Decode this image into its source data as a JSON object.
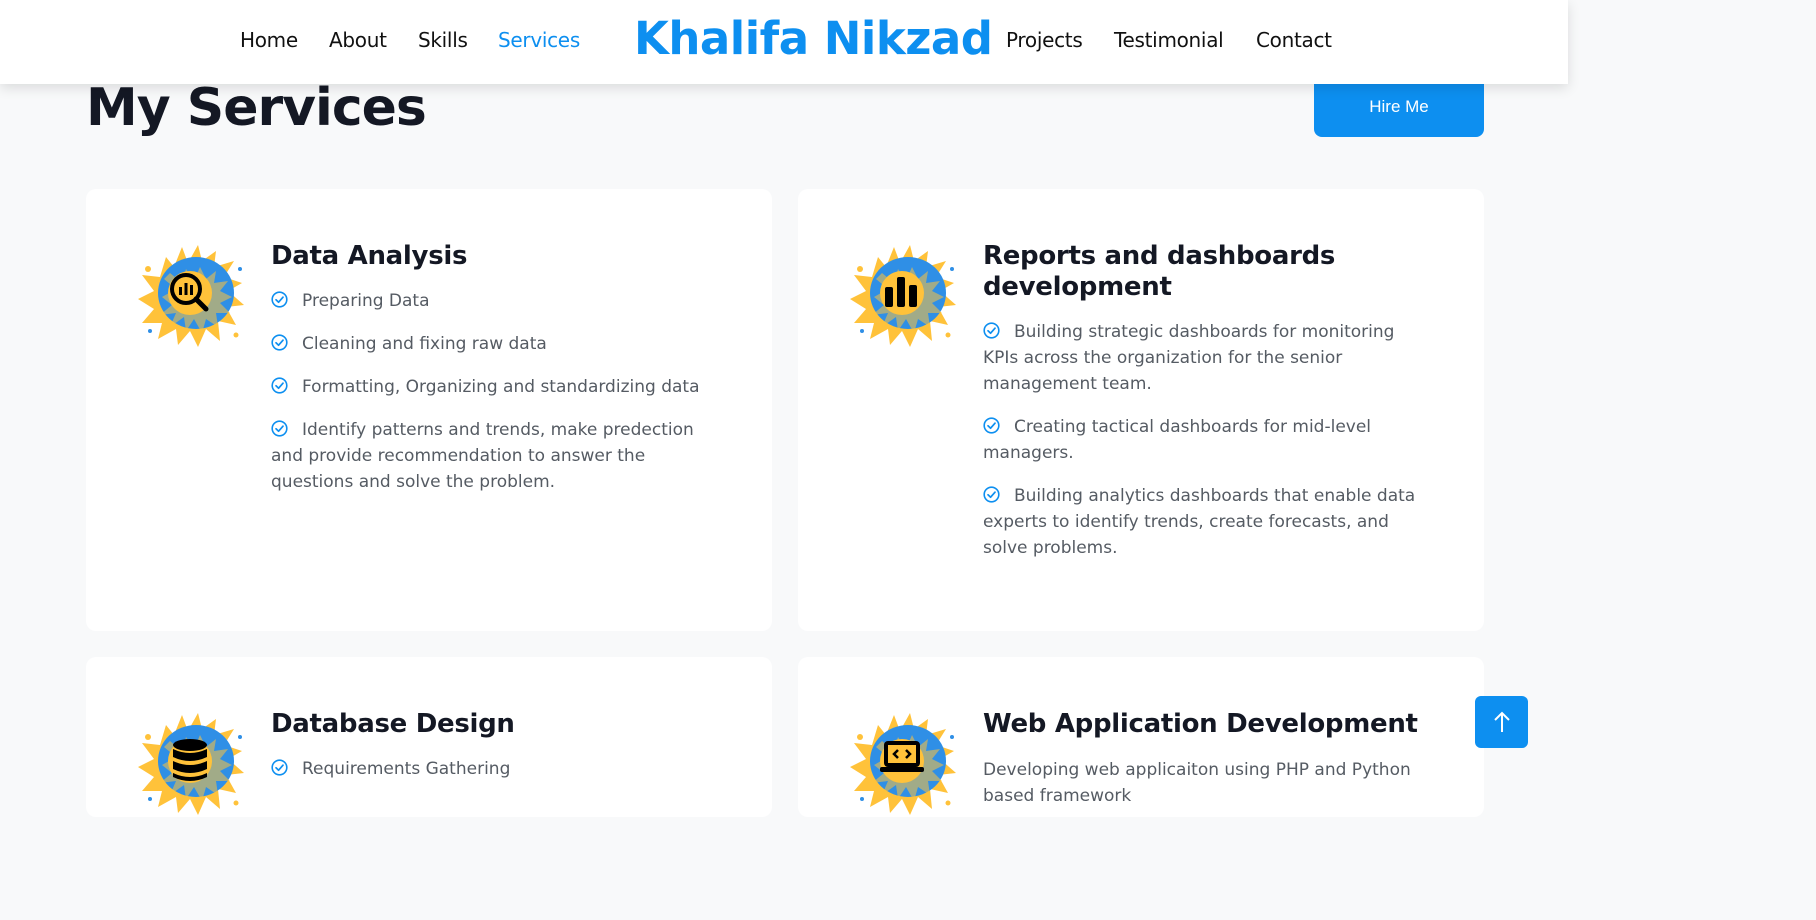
{
  "nav": {
    "home": "Home",
    "about": "About",
    "skills": "Skills",
    "services": "Services",
    "brand": "Khalifa Nikzad",
    "projects": "Projects",
    "testimonial": "Testimonial",
    "contact": "Contact"
  },
  "page": {
    "title": "My Services",
    "hire_label": "Hire Me"
  },
  "services": [
    {
      "title": "Data Analysis",
      "icon": "magnifier-chart-icon",
      "items": [
        "Preparing Data",
        "Cleaning and fixing raw data",
        "Formatting, Organizing and standardizing data",
        "Identify patterns and trends, make predection and provide recommendation to answer the questions and solve the problem."
      ]
    },
    {
      "title": "Reports and dashboards development",
      "icon": "bar-chart-icon",
      "items": [
        "Building strategic dashboards for monitoring KPIs across the organization for the senior management team.",
        "Creating tactical dashboards for mid-level managers.",
        "Building analytics dashboards that enable data experts to identify trends, create forecasts, and solve problems."
      ]
    },
    {
      "title": "Database Design",
      "icon": "database-icon",
      "items": [
        "Requirements Gathering"
      ]
    },
    {
      "title": "Web Application Development",
      "icon": "laptop-code-icon",
      "description": "Developing web applicaiton using PHP and Python based framework"
    }
  ],
  "colors": {
    "accent": "#0d8ff0",
    "splash_blue": "#2f8fe6",
    "splash_yellow": "#ffc23a",
    "heading": "#141824",
    "body_text": "#555b63",
    "background": "#f8f9fa"
  },
  "back_to_top_icon": "arrow-up-icon"
}
